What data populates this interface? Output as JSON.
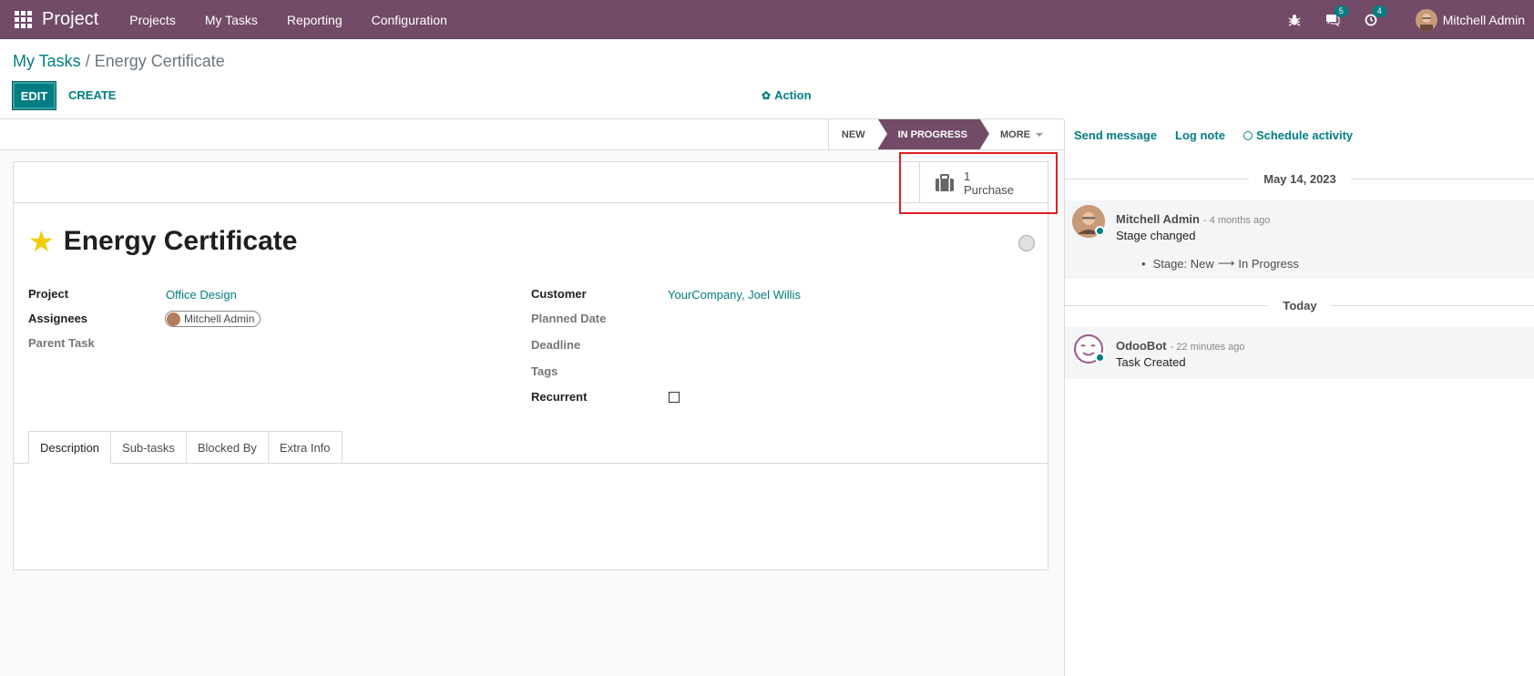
{
  "navbar": {
    "brand": "Project",
    "menu": [
      "Projects",
      "My Tasks",
      "Reporting",
      "Configuration"
    ],
    "chat_count": "5",
    "activity_count": "4",
    "user_name": "Mitchell Admin",
    "bg_color": "#714b67"
  },
  "breadcrumb": {
    "parent": "My Tasks",
    "separator": "/",
    "current": "Energy Certificate"
  },
  "control": {
    "edit_label": "EDIT",
    "create_label": "CREATE",
    "action_label": "Action"
  },
  "statusbar": {
    "stages": [
      "NEW",
      "IN PROGRESS",
      "MORE"
    ],
    "active_stage": "IN PROGRESS"
  },
  "smart_button": {
    "count": "1",
    "label": "Purchase",
    "icon": "briefcase-icon"
  },
  "task": {
    "title": "Energy Certificate",
    "priority_icon": "star-icon"
  },
  "fields": {
    "project_label": "Project",
    "project_value": "Office Design",
    "assignees_label": "Assignees",
    "assignee_value": "Mitchell Admin",
    "parent_label": "Parent Task",
    "customer_label": "Customer",
    "customer_value": "YourCompany, Joel Willis",
    "planned_label": "Planned Date",
    "deadline_label": "Deadline",
    "tags_label": "Tags",
    "recurrent_label": "Recurrent"
  },
  "tabs": [
    "Description",
    "Sub-tasks",
    "Blocked By",
    "Extra Info"
  ],
  "chatter": {
    "send_message": "Send message",
    "log_note": "Log note",
    "schedule_activity": "Schedule activity",
    "date1": "May 14, 2023",
    "msg1_author": "Mitchell Admin",
    "msg1_ago": "- 4 months ago",
    "msg1_body": "Stage changed",
    "msg1_tracking": "Stage: New",
    "msg1_tracking_arrow": "⟶",
    "msg1_tracking_new": "In Progress",
    "date2": "Today",
    "msg2_author": "OdooBot",
    "msg2_ago": "- 22 minutes ago",
    "msg2_body": "Task Created"
  },
  "colors": {
    "primary": "#017e84",
    "brand": "#714b67",
    "star": "#f3cc00",
    "highlight": "#e02020"
  }
}
